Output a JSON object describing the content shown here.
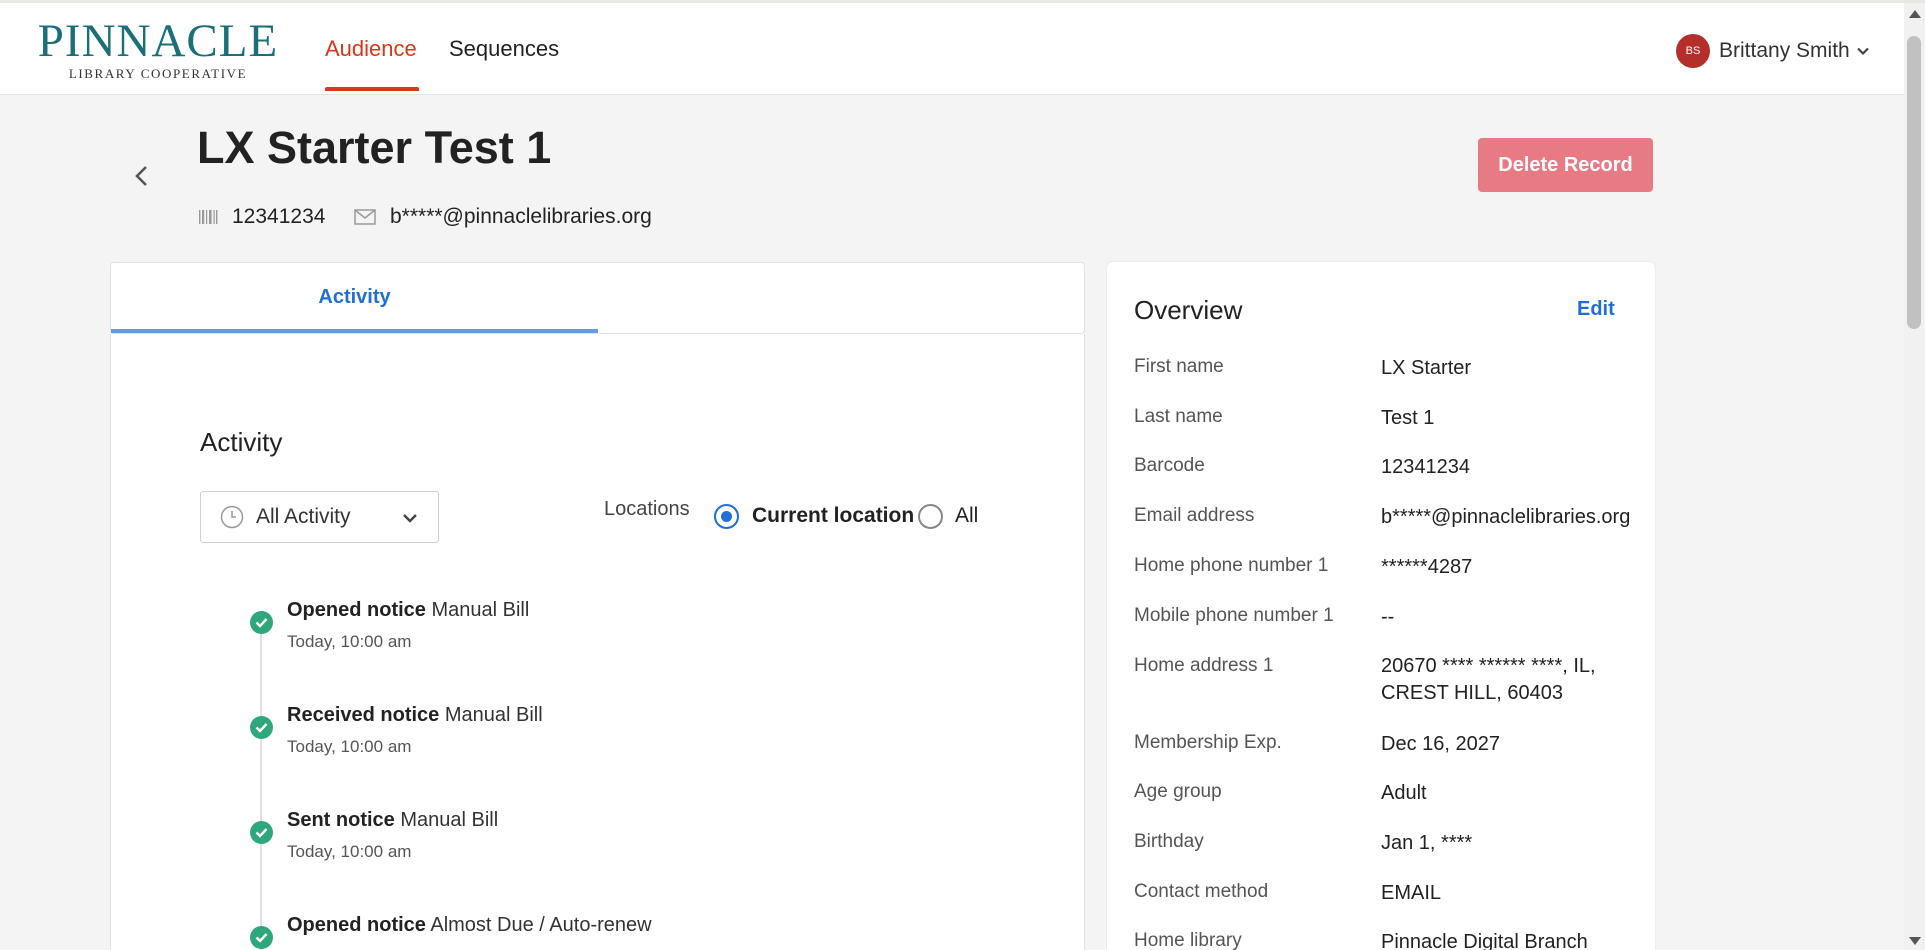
{
  "header": {
    "logo_main": "PINNACLE",
    "logo_sub": "LIBRARY COOPERATIVE",
    "tabs": [
      {
        "label": "Audience",
        "active": true
      },
      {
        "label": "Sequences",
        "active": false
      }
    ],
    "user": {
      "initials": "BS",
      "name": "Brittany Smith"
    }
  },
  "record": {
    "title": "LX Starter Test 1",
    "barcode": "12341234",
    "email": "b*****@pinnaclelibraries.org",
    "delete_label": "Delete Record"
  },
  "activity": {
    "tab_label": "Activity",
    "section_title": "Activity",
    "filter_value": "All Activity",
    "locations_label": "Locations",
    "location_options": [
      {
        "label": "Current location",
        "selected": true
      },
      {
        "label": "All",
        "selected": false
      }
    ],
    "events": [
      {
        "action": "Opened notice",
        "detail": "Manual Bill",
        "time": "Today, 10:00 am"
      },
      {
        "action": "Received notice",
        "detail": "Manual Bill",
        "time": "Today, 10:00 am"
      },
      {
        "action": "Sent notice",
        "detail": "Manual Bill",
        "time": "Today, 10:00 am"
      },
      {
        "action": "Opened notice",
        "detail": "Almost Due / Auto-renew",
        "time": ""
      }
    ]
  },
  "overview": {
    "title": "Overview",
    "edit_label": "Edit",
    "fields": [
      {
        "label": "First name",
        "value": "LX Starter"
      },
      {
        "label": "Last name",
        "value": "Test 1"
      },
      {
        "label": "Barcode",
        "value": "12341234"
      },
      {
        "label": "Email address",
        "value": "b*****@pinnaclelibraries.org"
      },
      {
        "label": "Home phone number 1",
        "value": "******4287"
      },
      {
        "label": "Mobile phone number 1",
        "value": "--"
      },
      {
        "label": "Home address 1",
        "value": "20670 **** ****** ****, IL, CREST HILL, 60403"
      },
      {
        "label": "Membership Exp.",
        "value": "Dec 16, 2027"
      },
      {
        "label": "Age group",
        "value": "Adult"
      },
      {
        "label": "Birthday",
        "value": "Jan 1, ****"
      },
      {
        "label": "Contact method",
        "value": "EMAIL"
      },
      {
        "label": "Home library",
        "value": "Pinnacle Digital Branch"
      }
    ]
  },
  "colors": {
    "accent_red": "#d9361b",
    "link_blue": "#1f6fd6",
    "delete_button": "#e77a83",
    "success_green": "#2fa77c",
    "logo_teal": "#1b6f78"
  },
  "icons": [
    "barcode-icon",
    "mail-icon",
    "clock-icon",
    "chevron-down-icon",
    "chevron-left-icon",
    "check-icon"
  ]
}
